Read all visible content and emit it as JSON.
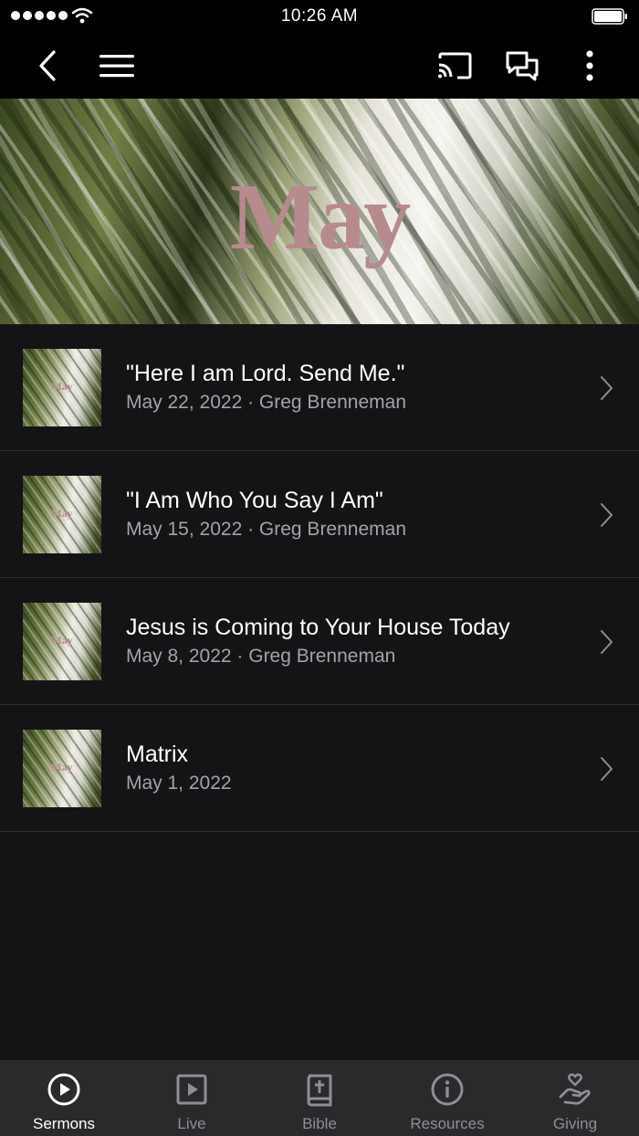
{
  "status_bar": {
    "time": "10:26 AM"
  },
  "nav": {
    "back_icon": "chevron-left-icon",
    "menu_icon": "hamburger-menu-icon",
    "cast_icon": "cast-icon",
    "chat_icon": "chat-bubbles-icon",
    "more_icon": "more-vertical-icon"
  },
  "hero": {
    "title": "May"
  },
  "sermons": [
    {
      "thumb_text": "May",
      "title": "\"Here I am Lord. Send Me.\"",
      "subtitle": "May 22, 2022 · Greg Brenneman"
    },
    {
      "thumb_text": "May",
      "title": "\"I Am Who You Say I Am\"",
      "subtitle": "May 15, 2022 · Greg Brenneman"
    },
    {
      "thumb_text": "May",
      "title": "Jesus is Coming to Your House Today",
      "subtitle": "May 8, 2022 · Greg Brenneman"
    },
    {
      "thumb_text": "May",
      "title": "Matrix",
      "subtitle": "May 1, 2022"
    }
  ],
  "tabs": [
    {
      "label": "Sermons",
      "icon": "play-circle-icon",
      "active": true
    },
    {
      "label": "Live",
      "icon": "play-square-icon",
      "active": false
    },
    {
      "label": "Bible",
      "icon": "bible-icon",
      "active": false
    },
    {
      "label": "Resources",
      "icon": "info-circle-icon",
      "active": false
    },
    {
      "label": "Giving",
      "icon": "heart-hand-icon",
      "active": false
    }
  ],
  "colors": {
    "accent_title": "#b78a8e",
    "background": "#141416",
    "tab_bar": "#2a2a2d"
  }
}
